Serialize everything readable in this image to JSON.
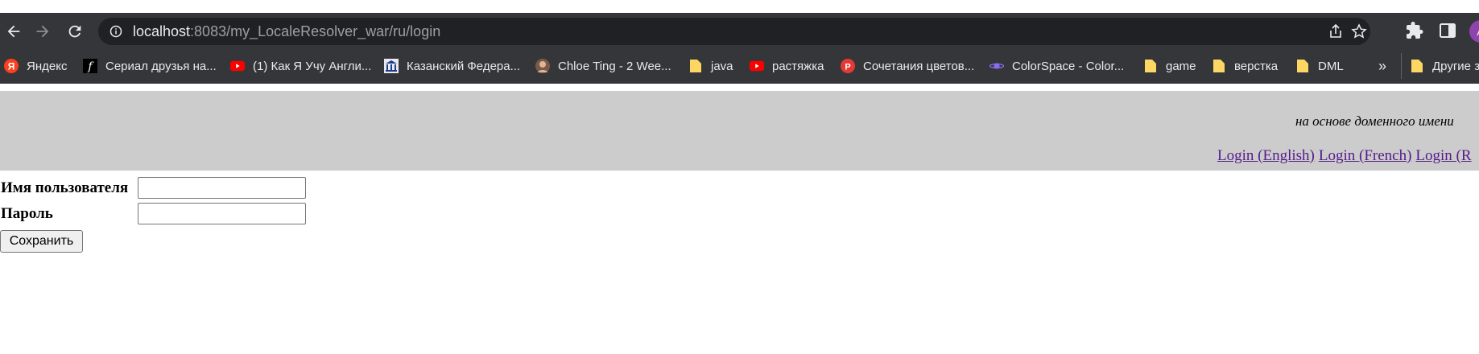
{
  "browser": {
    "url_host": "localhost",
    "url_rest": ":8083/my_LocaleResolver_war/ru/login",
    "avatar_letter": "A",
    "bookmarks": [
      {
        "label": "Яндекс",
        "icon": "yandex-icon"
      },
      {
        "label": "Сериал друзья на...",
        "icon": "f-icon"
      },
      {
        "label": "(1) Как Я Учу Англи...",
        "icon": "youtube-icon"
      },
      {
        "label": "Казанский Федера...",
        "icon": "university-icon"
      },
      {
        "label": "Chloe Ting - 2 Wee...",
        "icon": "avatar-icon"
      },
      {
        "label": "java",
        "icon": "folder-icon"
      },
      {
        "label": "растяжка",
        "icon": "youtube-icon"
      },
      {
        "label": "Сочетания цветов...",
        "icon": "palette-icon"
      },
      {
        "label": "ColorSpace - Color...",
        "icon": "planet-icon"
      },
      {
        "label": "game",
        "icon": "folder-icon"
      },
      {
        "label": "верстка",
        "icon": "folder-icon"
      },
      {
        "label": "DML",
        "icon": "folder-icon"
      }
    ],
    "overflow": "»",
    "other_bookmarks": "Другие з"
  },
  "header": {
    "subtitle": "на основе доменного имени",
    "links": [
      "Login (English)",
      "Login (French)",
      "Login (R"
    ]
  },
  "form": {
    "username_label": "Имя пользователя",
    "password_label": "Пароль",
    "username_value": "",
    "password_value": "",
    "submit_label": "Сохранить"
  },
  "colors": {
    "chrome": "#35363a",
    "omnibox": "#202124",
    "header_bg": "#cccccc",
    "link": "#551a8b"
  }
}
